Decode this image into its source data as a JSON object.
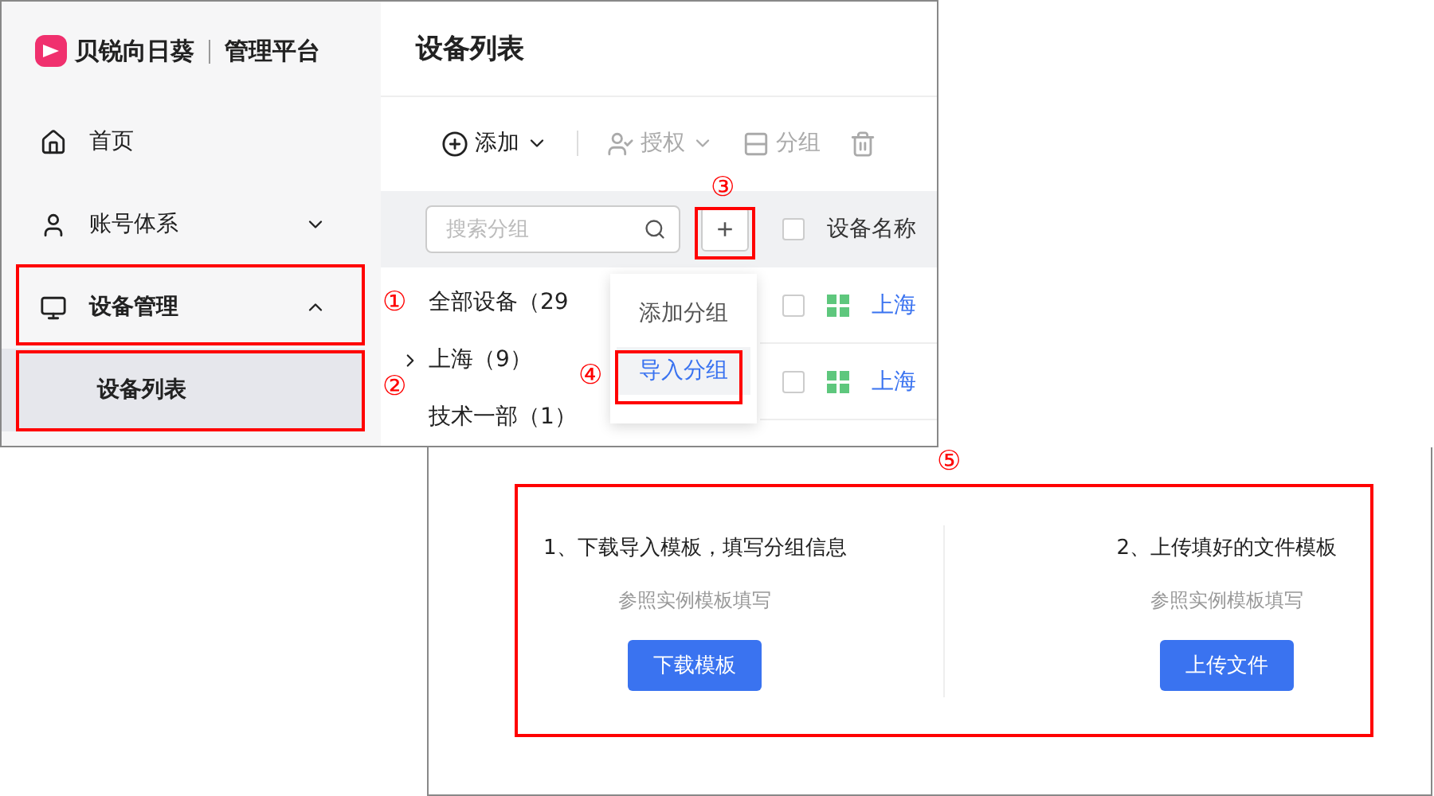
{
  "brand": {
    "name": "贝锐向日葵",
    "product": "管理平台"
  },
  "sidebar": {
    "items": [
      {
        "label": "首页",
        "kind": "home",
        "expanded": false,
        "selected": false
      },
      {
        "label": "账号体系",
        "kind": "account",
        "expanded": false,
        "selected": false
      },
      {
        "label": "设备管理",
        "kind": "device",
        "expanded": true,
        "selected": false,
        "children": [
          {
            "label": "设备列表",
            "selected": true
          }
        ]
      }
    ]
  },
  "page_title": "设备列表",
  "toolbar": [
    {
      "label": "添加",
      "kind": "add",
      "disabled": false,
      "dropdown": true
    },
    {
      "label": "授权",
      "kind": "auth",
      "disabled": true,
      "dropdown": true
    },
    {
      "label": "分组",
      "kind": "group",
      "disabled": true,
      "dropdown": false
    },
    {
      "kind": "delete",
      "disabled": true,
      "dropdown": false
    }
  ],
  "group_search": {
    "placeholder": "搜索分组"
  },
  "add_group_button": {
    "label": "+"
  },
  "group_tree": [
    {
      "label": "全部设备（29",
      "expandable": false
    },
    {
      "label": "上海（9）",
      "expandable": true,
      "expanded": false
    },
    {
      "label": "技术一部（1）",
      "expandable": false
    }
  ],
  "group_menu": [
    {
      "label": "添加分组",
      "selected": false
    },
    {
      "label": "导入分组",
      "selected": true
    }
  ],
  "table": {
    "columns": [
      "设备名称"
    ],
    "header_checked": false,
    "rows": [
      {
        "checked": false,
        "name": "上海"
      },
      {
        "checked": false,
        "name": "上海"
      }
    ]
  },
  "import_steps": [
    {
      "title": "1、下载导入模板，填写分组信息",
      "hint": "参照实例模板填写",
      "button": "下载模板"
    },
    {
      "title": "2、上传填好的文件模板",
      "hint": "参照实例模板填写",
      "button": "上传文件"
    }
  ],
  "callouts": [
    "①",
    "②",
    "③",
    "④",
    "⑤"
  ]
}
